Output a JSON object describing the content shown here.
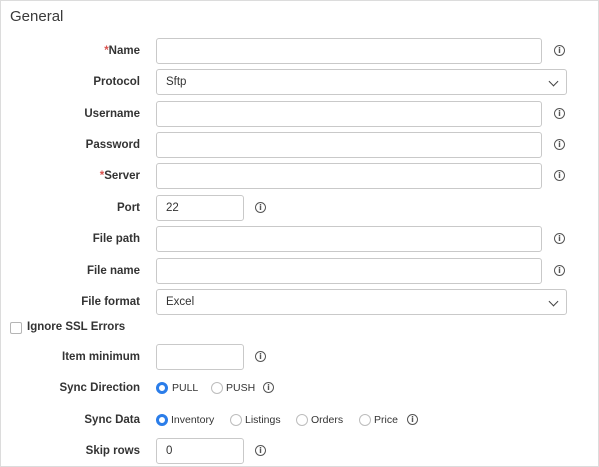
{
  "section": {
    "title": "General"
  },
  "fields": {
    "name": {
      "label": "Name",
      "required_mark": "*",
      "value": ""
    },
    "protocol": {
      "label": "Protocol",
      "value": "Sftp"
    },
    "username": {
      "label": "Username",
      "value": ""
    },
    "password": {
      "label": "Password",
      "value": ""
    },
    "server": {
      "label": "Server",
      "required_mark": "*",
      "value": ""
    },
    "port": {
      "label": "Port",
      "value": "22"
    },
    "file_path": {
      "label": "File path",
      "value": ""
    },
    "file_name": {
      "label": "File name",
      "value": ""
    },
    "file_format": {
      "label": "File format",
      "value": "Excel"
    },
    "ignore_ssl": {
      "label": "Ignore SSL Errors",
      "checked": false
    },
    "item_minimum": {
      "label": "Item minimum",
      "value": ""
    },
    "sync_direction": {
      "label": "Sync Direction",
      "options": [
        "PULL",
        "PUSH"
      ],
      "selected": "PULL"
    },
    "sync_data": {
      "label": "Sync Data",
      "options": [
        "Inventory",
        "Listings",
        "Orders",
        "Price"
      ],
      "selected": "Inventory"
    },
    "skip_rows": {
      "label": "Skip rows",
      "value": "0"
    }
  },
  "icons": {
    "info": "info-circle-icon",
    "dropdown": "chevron-down-icon",
    "info_glyph": "i"
  },
  "colors": {
    "accent": "#2b7de9",
    "required": "#d9534f",
    "border": "#c9c9c9"
  }
}
